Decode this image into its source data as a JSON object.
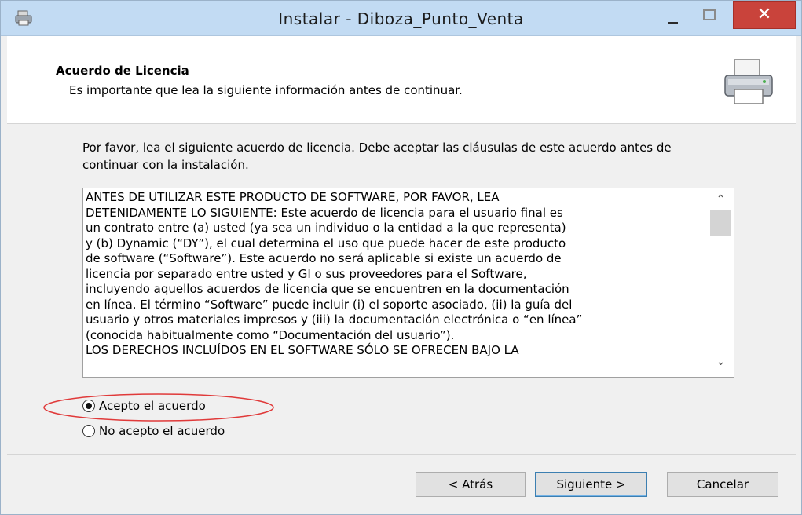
{
  "window": {
    "title": "Instalar - Diboza_Punto_Venta",
    "icon": "installer-icon"
  },
  "header": {
    "title": "Acuerdo de Licencia",
    "subtitle": "Es importante que lea la siguiente información antes de continuar.",
    "icon": "printer-icon"
  },
  "main": {
    "intro": "Por favor, lea el siguiente acuerdo de licencia. Debe aceptar las cláusulas de este acuerdo antes de continuar con la instalación.",
    "license_text": "ANTES DE UTILIZAR ESTE PRODUCTO DE SOFTWARE, POR FAVOR, LEA\nDETENIDAMENTE LO SIGUIENTE: Este acuerdo de licencia para el usuario final es\nun contrato entre (a) usted (ya sea un individuo o la entidad a la que representa)\ny (b) Dynamic (“DY”), el cual determina el uso que puede hacer de este producto\nde software (“Software”). Este acuerdo no será aplicable si existe un acuerdo de\nlicencia por separado entre usted y GI o sus proveedores para el Software,\nincluyendo aquellos acuerdos de licencia que se encuentren en la documentación\nen línea. El término “Software” puede incluir (i) el soporte asociado, (ii) la guía del\nusuario y otros materiales impresos y (iii) la documentación electrónica o “en línea”\n(conocida habitualmente como “Documentación del usuario”).\nLOS DERECHOS INCLUÍDOS EN EL SOFTWARE SÓLO SE OFRECEN BAJO LA",
    "options": [
      {
        "label": "Acepto el acuerdo",
        "selected": true
      },
      {
        "label": "No acepto el acuerdo",
        "selected": false
      }
    ]
  },
  "buttons": {
    "back": "< Atrás",
    "next": "Siguiente >",
    "cancel": "Cancelar"
  },
  "colors": {
    "titlebar": "#c2dbf3",
    "close": "#c9433b",
    "annotation": "#e03a3a"
  }
}
